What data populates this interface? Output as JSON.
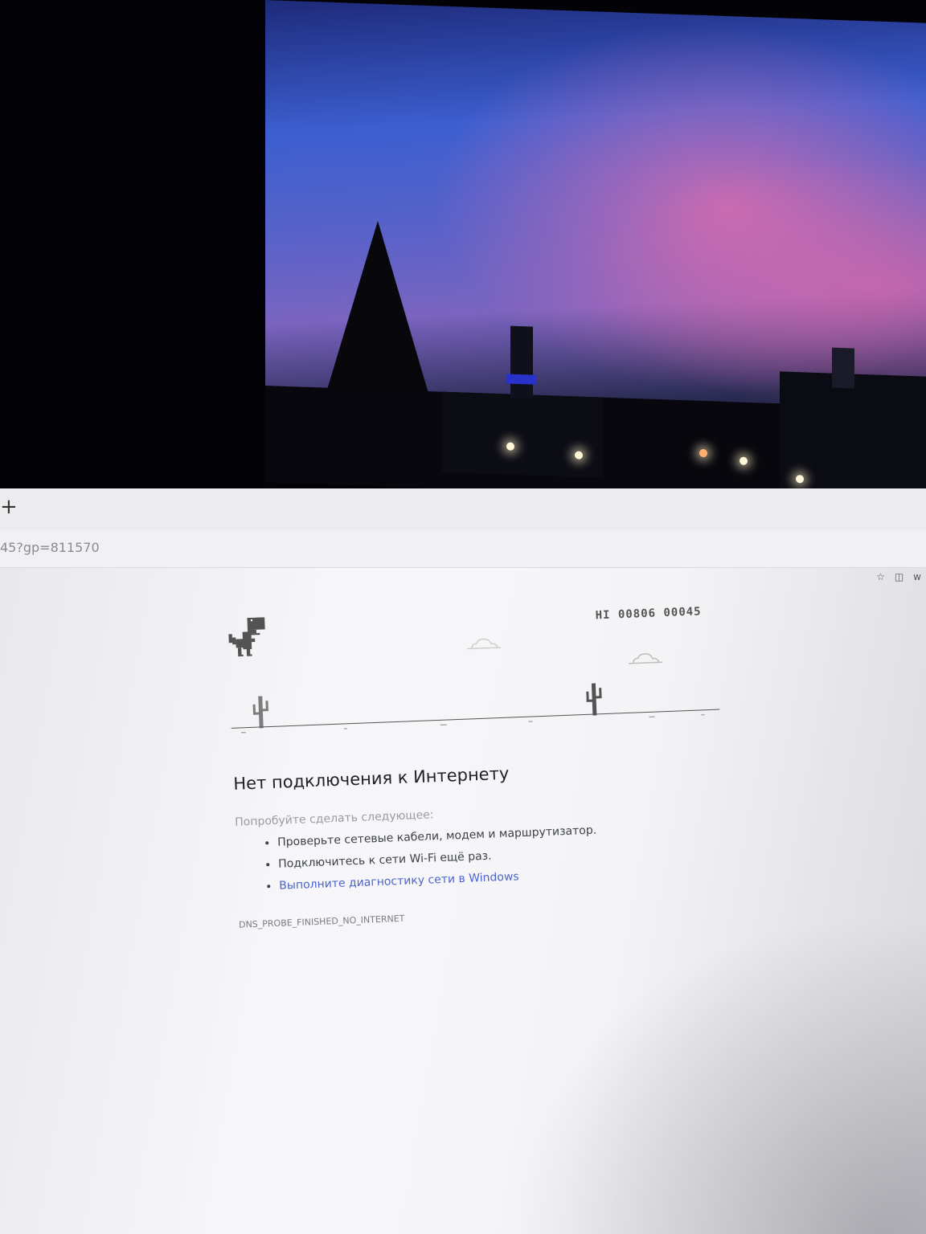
{
  "browser": {
    "new_tab_glyph": "+",
    "url_fragment": "45?gp=811570",
    "toolbar_icons": [
      "star-icon",
      "reader-icon",
      "extension-icon"
    ]
  },
  "game": {
    "score_text": "HI 00806 00045"
  },
  "error_page": {
    "headline": "Нет подключения к Интернету",
    "suggestion_intro": "Попробуйте сделать следующее:",
    "suggestions": [
      "Проверьте сетевые кабели, модем и маршрутизатор.",
      "Подключитесь к сети Wi-Fi ещё раз."
    ],
    "diagnostics_link": "Выполните диагностику сети в Windows",
    "error_code": "DNS_PROBE_FINISHED_NO_INTERNET"
  },
  "colors": {
    "link": "#4b63c8",
    "game_gray": "#535353"
  }
}
